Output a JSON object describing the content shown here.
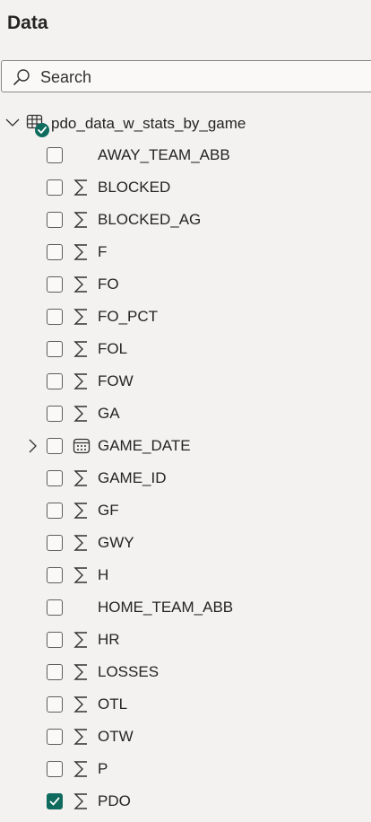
{
  "pane": {
    "title": "Data"
  },
  "search": {
    "placeholder": "Search"
  },
  "table": {
    "name": "pdo_data_w_stats_by_game"
  },
  "fields": [
    {
      "label": "AWAY_TEAM_ABB",
      "type": "text",
      "checked": false,
      "expandable": false
    },
    {
      "label": "BLOCKED",
      "type": "sum",
      "checked": false,
      "expandable": false
    },
    {
      "label": "BLOCKED_AG",
      "type": "sum",
      "checked": false,
      "expandable": false
    },
    {
      "label": "F",
      "type": "sum",
      "checked": false,
      "expandable": false
    },
    {
      "label": "FO",
      "type": "sum",
      "checked": false,
      "expandable": false
    },
    {
      "label": "FO_PCT",
      "type": "sum",
      "checked": false,
      "expandable": false
    },
    {
      "label": "FOL",
      "type": "sum",
      "checked": false,
      "expandable": false
    },
    {
      "label": "FOW",
      "type": "sum",
      "checked": false,
      "expandable": false
    },
    {
      "label": "GA",
      "type": "sum",
      "checked": false,
      "expandable": false
    },
    {
      "label": "GAME_DATE",
      "type": "date",
      "checked": false,
      "expandable": true
    },
    {
      "label": "GAME_ID",
      "type": "sum",
      "checked": false,
      "expandable": false
    },
    {
      "label": "GF",
      "type": "sum",
      "checked": false,
      "expandable": false
    },
    {
      "label": "GWY",
      "type": "sum",
      "checked": false,
      "expandable": false
    },
    {
      "label": "H",
      "type": "sum",
      "checked": false,
      "expandable": false
    },
    {
      "label": "HOME_TEAM_ABB",
      "type": "text",
      "checked": false,
      "expandable": false
    },
    {
      "label": "HR",
      "type": "sum",
      "checked": false,
      "expandable": false
    },
    {
      "label": "LOSSES",
      "type": "sum",
      "checked": false,
      "expandable": false
    },
    {
      "label": "OTL",
      "type": "sum",
      "checked": false,
      "expandable": false
    },
    {
      "label": "OTW",
      "type": "sum",
      "checked": false,
      "expandable": false
    },
    {
      "label": "P",
      "type": "sum",
      "checked": false,
      "expandable": false
    },
    {
      "label": "PDO",
      "type": "sum",
      "checked": true,
      "expandable": false
    }
  ],
  "colors": {
    "accent": "#0f6b5e",
    "background": "#f3f2f1",
    "text": "#252423"
  }
}
